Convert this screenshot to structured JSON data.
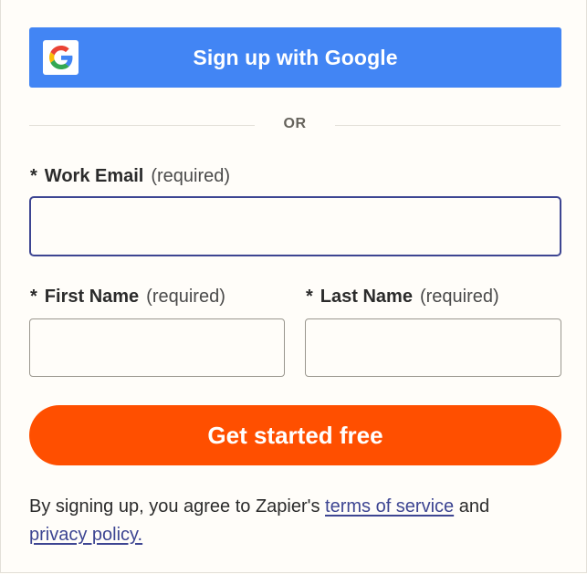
{
  "google_button": {
    "label": "Sign up with Google",
    "icon": "google-g-icon"
  },
  "divider": {
    "text": "OR"
  },
  "work_email": {
    "required_marker": "*",
    "label": "Work Email",
    "hint": "(required)",
    "value": ""
  },
  "first_name": {
    "required_marker": "*",
    "label": "First Name",
    "hint": "(required)",
    "value": ""
  },
  "last_name": {
    "required_marker": "*",
    "label": "Last Name",
    "hint": "(required)",
    "value": ""
  },
  "submit": {
    "label": "Get started free"
  },
  "legal": {
    "prefix": "By signing up, you agree to Zapier's ",
    "terms_link": "terms of service",
    "middle": " and",
    "privacy_link": "privacy policy."
  },
  "colors": {
    "google_blue": "#4285f4",
    "brand_orange": "#ff4f00",
    "link": "#3d4592",
    "focus_border": "#3d4592",
    "background": "#fffdf9"
  }
}
